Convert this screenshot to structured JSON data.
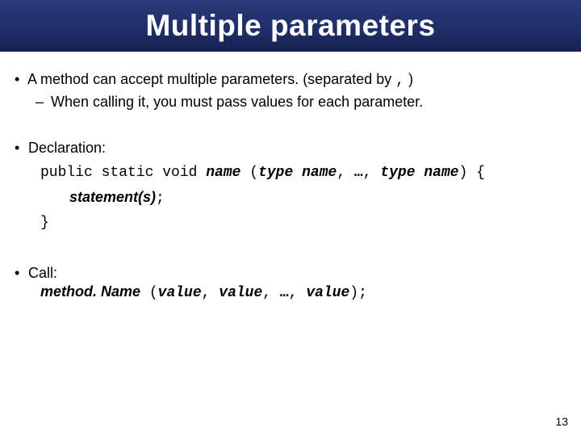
{
  "title": "Multiple parameters",
  "b1": "A method can accept multiple parameters. (separated by",
  "b1_comma": ",",
  "b1_end": ")",
  "b1_sub": "When calling it, you must pass values for each parameter.",
  "b2": "Declaration:",
  "decl": {
    "prefix": "public static void ",
    "name1": "name",
    "open": " (",
    "type1": "type",
    "sp": " ",
    "argname1": "name",
    "comma1": ", ",
    "dots": "…",
    "comma2": ", ",
    "type2": "type",
    "argname2": "name",
    "close": ")",
    "brace": " {"
  },
  "stmt": "statement(s)",
  "stmt_semi": ";",
  "close_brace": "}",
  "b3": "Call:",
  "call": {
    "method": "method. Name",
    "open": " (",
    "v1": "value",
    "comma1": ", ",
    "v2": "value",
    "comma2": ", ",
    "dots": "…",
    "comma3": ", ",
    "v3": "value",
    "close": ")",
    "semi": ";"
  },
  "pagenum": "13"
}
